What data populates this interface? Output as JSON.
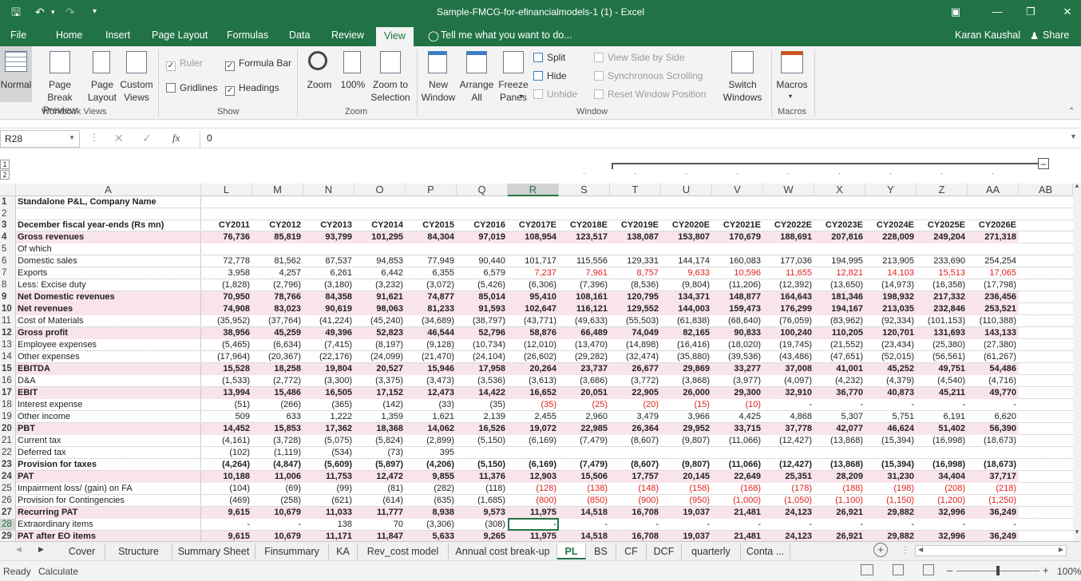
{
  "window": {
    "title": "Sample-FMCG-for-efinancialmodels-1 (1) - Excel"
  },
  "ribbon_tabs": [
    "File",
    "Home",
    "Insert",
    "Page Layout",
    "Formulas",
    "Data",
    "Review",
    "View"
  ],
  "tell_me": "Tell me what you want to do...",
  "user": "Karan Kaushal",
  "share": "Share",
  "groups": {
    "workbook_views": {
      "label": "Workbook Views",
      "normal": "Normal",
      "page_break": "Page Break\nPreview",
      "page_layout": "Page\nLayout",
      "custom_views": "Custom\nViews"
    },
    "show": {
      "label": "Show",
      "ruler": "Ruler",
      "formula_bar": "Formula Bar",
      "gridlines": "Gridlines",
      "headings": "Headings"
    },
    "zoom": {
      "label": "Zoom",
      "zoom": "Zoom",
      "hundred": "100%",
      "zoom_to_selection": "Zoom to\nSelection"
    },
    "window": {
      "label": "Window",
      "new_window": "New\nWindow",
      "arrange_all": "Arrange\nAll",
      "freeze_panes": "Freeze\nPanes",
      "split": "Split",
      "hide": "Hide",
      "unhide": "Unhide",
      "view_side": "View Side by Side",
      "sync_scroll": "Synchronous Scrolling",
      "reset_pos": "Reset Window Position",
      "switch_windows": "Switch\nWindows"
    },
    "macros": {
      "label": "Macros",
      "macros": "Macros"
    }
  },
  "formula_bar": {
    "name_box": "R28",
    "formula": "0"
  },
  "outline_levels": [
    "1",
    "2"
  ],
  "columns": [
    "A",
    "L",
    "M",
    "N",
    "O",
    "P",
    "Q",
    "R",
    "S",
    "T",
    "U",
    "V",
    "W",
    "X",
    "Y",
    "Z",
    "AA",
    "AB"
  ],
  "rows": [
    {
      "n": "1",
      "label": "Standalone P&L, Company Name",
      "bold": true,
      "values": []
    },
    {
      "n": "2",
      "label": "",
      "values": []
    },
    {
      "n": "3",
      "label": "December fiscal year-ends (Rs mn)",
      "bold": true,
      "values": [
        "CY2011",
        "CY2012",
        "CY2013",
        "CY2014",
        "CY2015",
        "CY2016",
        "CY2017E",
        "CY2018E",
        "CY2019E",
        "CY2020E",
        "CY2021E",
        "CY2022E",
        "CY2023E",
        "CY2024E",
        "CY2025E",
        "CY2026E"
      ]
    },
    {
      "n": "4",
      "label": "Gross revenues",
      "bold": true,
      "pink": true,
      "values": [
        "76,736",
        "85,819",
        "93,799",
        "101,295",
        "84,304",
        "97,019",
        "108,954",
        "123,517",
        "138,087",
        "153,807",
        "170,679",
        "188,691",
        "207,816",
        "228,009",
        "249,204",
        "271,318"
      ]
    },
    {
      "n": "5",
      "label": "   Of which",
      "values": []
    },
    {
      "n": "6",
      "label": "   Domestic sales",
      "values": [
        "72,778",
        "81,562",
        "87,537",
        "94,853",
        "77,949",
        "90,440",
        "101,717",
        "115,556",
        "129,331",
        "144,174",
        "160,083",
        "177,036",
        "194,995",
        "213,905",
        "233,690",
        "254,254"
      ]
    },
    {
      "n": "7",
      "label": "   Exports",
      "values": [
        "3,958",
        "4,257",
        "6,261",
        "6,442",
        "6,355",
        "6,579",
        "7,237",
        "7,961",
        "8,757",
        "9,633",
        "10,596",
        "11,655",
        "12,821",
        "14,103",
        "15,513",
        "17,065"
      ],
      "red_from": 6
    },
    {
      "n": "8",
      "label": "Less: Excise duty",
      "values": [
        "(1,828)",
        "(2,796)",
        "(3,180)",
        "(3,232)",
        "(3,072)",
        "(5,426)",
        "(6,306)",
        "(7,396)",
        "(8,536)",
        "(9,804)",
        "(11,206)",
        "(12,392)",
        "(13,650)",
        "(14,973)",
        "(16,358)",
        "(17,798)"
      ]
    },
    {
      "n": "9",
      "label": "Net Domestic revenues",
      "bold": true,
      "pink": true,
      "values": [
        "70,950",
        "78,766",
        "84,358",
        "91,621",
        "74,877",
        "85,014",
        "95,410",
        "108,161",
        "120,795",
        "134,371",
        "148,877",
        "164,643",
        "181,346",
        "198,932",
        "217,332",
        "236,456"
      ]
    },
    {
      "n": "10",
      "label": "Net revenues",
      "bold": true,
      "pink": true,
      "values": [
        "74,908",
        "83,023",
        "90,619",
        "98,063",
        "81,233",
        "91,593",
        "102,647",
        "116,121",
        "129,552",
        "144,003",
        "159,473",
        "176,299",
        "194,167",
        "213,035",
        "232,846",
        "253,521"
      ]
    },
    {
      "n": "11",
      "label": "Cost of Materials",
      "values": [
        "(35,952)",
        "(37,764)",
        "(41,224)",
        "(45,240)",
        "(34,689)",
        "(38,797)",
        "(43,771)",
        "(49,633)",
        "(55,503)",
        "(61,838)",
        "(68,640)",
        "(76,059)",
        "(83,962)",
        "(92,334)",
        "(101,153)",
        "(110,388)"
      ]
    },
    {
      "n": "12",
      "label": "Gross profit",
      "bold": true,
      "pink": true,
      "values": [
        "38,956",
        "45,259",
        "49,396",
        "52,823",
        "46,544",
        "52,796",
        "58,876",
        "66,489",
        "74,049",
        "82,165",
        "90,833",
        "100,240",
        "110,205",
        "120,701",
        "131,693",
        "143,133"
      ]
    },
    {
      "n": "13",
      "label": "Employee expenses",
      "values": [
        "(5,465)",
        "(6,634)",
        "(7,415)",
        "(8,197)",
        "(9,128)",
        "(10,734)",
        "(12,010)",
        "(13,470)",
        "(14,898)",
        "(16,416)",
        "(18,020)",
        "(19,745)",
        "(21,552)",
        "(23,434)",
        "(25,380)",
        "(27,380)"
      ]
    },
    {
      "n": "14",
      "label": "Other expenses",
      "values": [
        "(17,964)",
        "(20,367)",
        "(22,176)",
        "(24,099)",
        "(21,470)",
        "(24,104)",
        "(26,602)",
        "(29,282)",
        "(32,474)",
        "(35,880)",
        "(39,536)",
        "(43,486)",
        "(47,651)",
        "(52,015)",
        "(56,561)",
        "(61,267)"
      ]
    },
    {
      "n": "15",
      "label": "EBITDA",
      "bold": true,
      "pink": true,
      "values": [
        "15,528",
        "18,258",
        "19,804",
        "20,527",
        "15,946",
        "17,958",
        "20,264",
        "23,737",
        "26,677",
        "29,869",
        "33,277",
        "37,008",
        "41,001",
        "45,252",
        "49,751",
        "54,486"
      ]
    },
    {
      "n": "16",
      "label": "D&A",
      "values": [
        "(1,533)",
        "(2,772)",
        "(3,300)",
        "(3,375)",
        "(3,473)",
        "(3,536)",
        "(3,613)",
        "(3,686)",
        "(3,772)",
        "(3,868)",
        "(3,977)",
        "(4,097)",
        "(4,232)",
        "(4,379)",
        "(4,540)",
        "(4,716)"
      ]
    },
    {
      "n": "17",
      "label": "EBIT",
      "bold": true,
      "pink": true,
      "values": [
        "13,994",
        "15,486",
        "16,505",
        "17,152",
        "12,473",
        "14,422",
        "16,652",
        "20,051",
        "22,905",
        "26,000",
        "29,300",
        "32,910",
        "36,770",
        "40,873",
        "45,211",
        "49,770"
      ]
    },
    {
      "n": "18",
      "label": "Interest expense",
      "values": [
        "(51)",
        "(266)",
        "(365)",
        "(142)",
        "(33)",
        "(35)",
        "(35)",
        "(25)",
        "(20)",
        "(15)",
        "(10)",
        "-",
        "-",
        "-",
        "-",
        "-"
      ],
      "red_from": 6,
      "red_to": 10
    },
    {
      "n": "19",
      "label": "Other income",
      "values": [
        "509",
        "633",
        "1,222",
        "1,359",
        "1,621",
        "2,139",
        "2,455",
        "2,960",
        "3,479",
        "3,966",
        "4,425",
        "4,868",
        "5,307",
        "5,751",
        "6,191",
        "6,620"
      ]
    },
    {
      "n": "20",
      "label": "PBT",
      "bold": true,
      "pink": true,
      "values": [
        "14,452",
        "15,853",
        "17,362",
        "18,368",
        "14,062",
        "16,526",
        "19,072",
        "22,985",
        "26,364",
        "29,952",
        "33,715",
        "37,778",
        "42,077",
        "46,624",
        "51,402",
        "56,390"
      ]
    },
    {
      "n": "21",
      "label": "Current tax",
      "values": [
        "(4,161)",
        "(3,728)",
        "(5,075)",
        "(5,824)",
        "(2,899)",
        "(5,150)",
        "(6,169)",
        "(7,479)",
        "(8,607)",
        "(9,807)",
        "(11,066)",
        "(12,427)",
        "(13,868)",
        "(15,394)",
        "(16,998)",
        "(18,673)"
      ]
    },
    {
      "n": "22",
      "label": "Deferred tax",
      "values": [
        "(102)",
        "(1,119)",
        "(534)",
        "(73)",
        "395",
        "",
        "",
        "",
        "",
        "",
        "",
        "",
        "",
        "",
        "",
        ""
      ]
    },
    {
      "n": "23",
      "label": "Provision for taxes",
      "bold": true,
      "values": [
        "(4,264)",
        "(4,847)",
        "(5,609)",
        "(5,897)",
        "(4,206)",
        "(5,150)",
        "(6,169)",
        "(7,479)",
        "(8,607)",
        "(9,807)",
        "(11,066)",
        "(12,427)",
        "(13,868)",
        "(15,394)",
        "(16,998)",
        "(18,673)"
      ]
    },
    {
      "n": "24",
      "label": "PAT",
      "bold": true,
      "pink": true,
      "values": [
        "10,188",
        "11,006",
        "11,753",
        "12,472",
        "9,855",
        "11,376",
        "12,903",
        "15,506",
        "17,757",
        "20,145",
        "22,649",
        "25,351",
        "28,209",
        "31,230",
        "34,404",
        "37,717"
      ]
    },
    {
      "n": "25",
      "label": "Impairment loss/ (gain) on FA",
      "values": [
        "(104)",
        "(69)",
        "(99)",
        "(81)",
        "(282)",
        "(118)",
        "(128)",
        "(138)",
        "(148)",
        "(158)",
        "(168)",
        "(178)",
        "(188)",
        "(198)",
        "(208)",
        "(218)"
      ],
      "red_from": 6
    },
    {
      "n": "26",
      "label": "Provision for Contingencies",
      "values": [
        "(469)",
        "(258)",
        "(621)",
        "(614)",
        "(635)",
        "(1,685)",
        "(800)",
        "(850)",
        "(900)",
        "(950)",
        "(1,000)",
        "(1,050)",
        "(1,100)",
        "(1,150)",
        "(1,200)",
        "(1,250)"
      ],
      "red_from": 6
    },
    {
      "n": "27",
      "label": "Recurring PAT",
      "bold": true,
      "pink": true,
      "values": [
        "9,615",
        "10,679",
        "11,033",
        "11,777",
        "8,938",
        "9,573",
        "11,975",
        "14,518",
        "16,708",
        "19,037",
        "21,481",
        "24,123",
        "26,921",
        "29,882",
        "32,996",
        "36,249"
      ]
    },
    {
      "n": "28",
      "label": "Extraordinary items",
      "values": [
        "-",
        "-",
        "138",
        "70",
        "(3,306)",
        "(308)",
        "-",
        "-",
        "-",
        "-",
        "-",
        "-",
        "-",
        "-",
        "-",
        "-"
      ]
    },
    {
      "n": "29",
      "label": "PAT after EO items",
      "bold": true,
      "pink": true,
      "values": [
        "9,615",
        "10,679",
        "11,171",
        "11,847",
        "5,633",
        "9,265",
        "11,975",
        "14,518",
        "16,708",
        "19,037",
        "21,481",
        "24,123",
        "26,921",
        "29,882",
        "32,996",
        "36,249"
      ]
    }
  ],
  "sheet_tabs": [
    "Cover",
    "Structure",
    "Summary Sheet",
    "Finsummary",
    "KA",
    "Rev_cost model",
    "Annual cost break-up",
    "PL",
    "BS",
    "CF",
    "DCF",
    "quarterly",
    "Conta ..."
  ],
  "active_sheet": "PL",
  "status": {
    "ready": "Ready",
    "calculate": "Calculate",
    "zoom": "100%"
  },
  "colors": {
    "accent": "#217346",
    "pink_row": "#f8e4ea",
    "red_text": "#e0211c"
  }
}
